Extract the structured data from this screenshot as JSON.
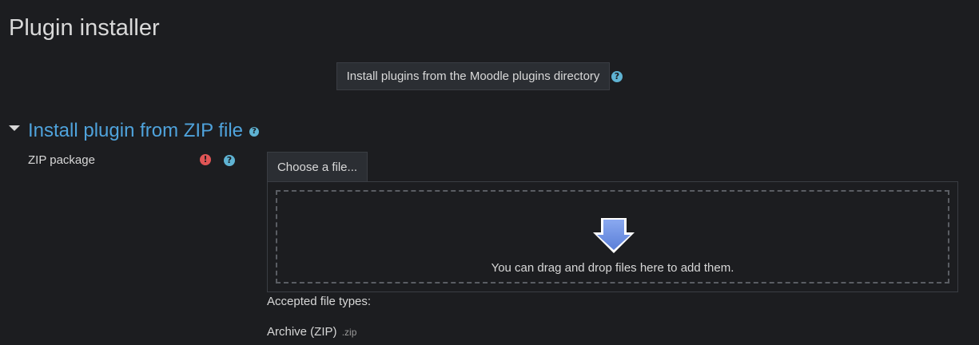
{
  "page": {
    "title": "Plugin installer"
  },
  "directory": {
    "button_label": "Install plugins from the Moodle plugins directory",
    "help_icon": "question-circle-icon"
  },
  "section": {
    "heading": "Install plugin from ZIP file",
    "help_icon": "question-circle-icon",
    "toggle_icon": "caret-down-icon"
  },
  "zip_field": {
    "label": "ZIP package",
    "required_icon": "exclamation-circle-icon",
    "help_icon": "question-circle-icon",
    "choose_label": "Choose a file...",
    "drop_text": "You can drag and drop files here to add them.",
    "drop_icon": "download-arrow-icon",
    "accepted_label": "Accepted file types:",
    "filetype_name": "Archive (ZIP)",
    "filetype_ext": ".zip"
  },
  "colors": {
    "background": "#1c1d20",
    "link": "#4fa3dc",
    "help": "#5fb3d3",
    "required": "#e05555",
    "arrow": "#6b8fe0"
  }
}
